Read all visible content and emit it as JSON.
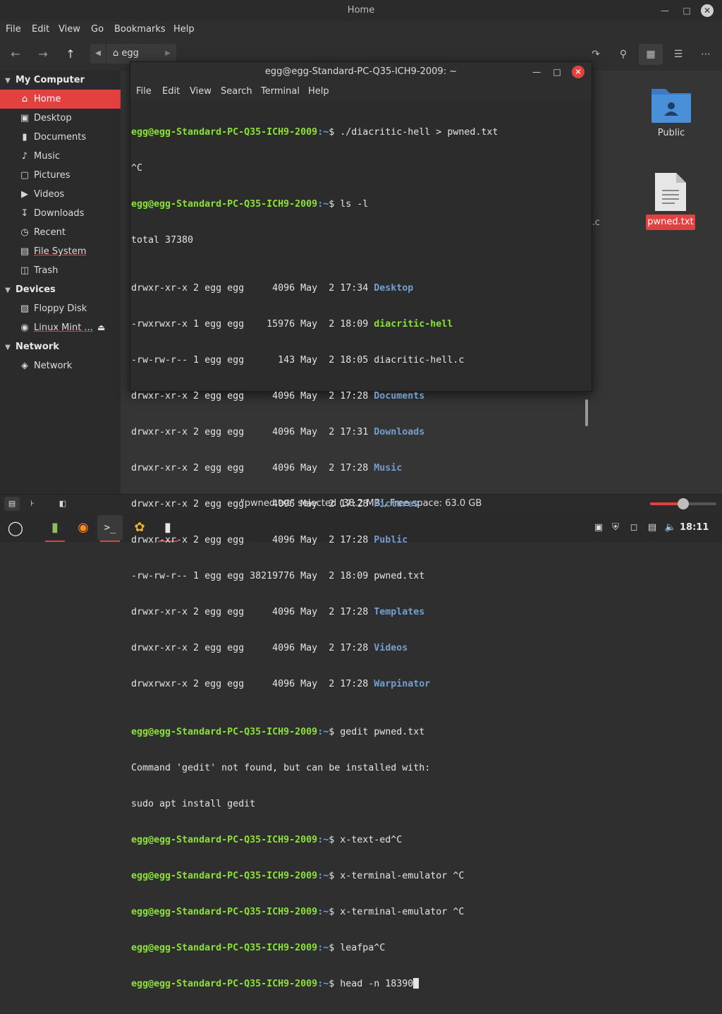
{
  "file_manager": {
    "title": "Home",
    "menu": [
      "File",
      "Edit",
      "View",
      "Go",
      "Bookmarks",
      "Help"
    ],
    "path_label": "egg",
    "sidebar": {
      "my_computer_header": "My Computer",
      "my_computer_items": [
        {
          "label": "Home",
          "icon": "home-icon",
          "active": true
        },
        {
          "label": "Desktop",
          "icon": "desktop-icon"
        },
        {
          "label": "Documents",
          "icon": "documents-icon"
        },
        {
          "label": "Music",
          "icon": "music-icon"
        },
        {
          "label": "Pictures",
          "icon": "pictures-icon"
        },
        {
          "label": "Videos",
          "icon": "videos-icon"
        },
        {
          "label": "Downloads",
          "icon": "downloads-icon"
        },
        {
          "label": "Recent",
          "icon": "recent-icon"
        },
        {
          "label": "File System",
          "icon": "filesystem-icon"
        },
        {
          "label": "Trash",
          "icon": "trash-icon"
        }
      ],
      "devices_header": "Devices",
      "devices_items": [
        {
          "label": "Floppy Disk",
          "icon": "floppy-icon"
        },
        {
          "label": "Linux Mint ...",
          "icon": "disc-icon"
        }
      ],
      "network_header": "Network",
      "network_items": [
        {
          "label": "Network",
          "icon": "network-icon"
        }
      ]
    },
    "content": {
      "public_label": "Public",
      "pwned_label": "pwned.txt",
      "partial_label": "l.c"
    },
    "status": "\"pwned.txt\" selected (38.2 MB), Free space: 63.0 GB",
    "zoom_level": 0.5
  },
  "terminal": {
    "title": "egg@egg-Standard-PC-Q35-ICH9-2009: ~",
    "menu": [
      "File",
      "Edit",
      "View",
      "Search",
      "Terminal",
      "Help"
    ],
    "prompt_user": "egg@egg-Standard-PC-Q35-ICH9-2009",
    "prompt_path": ":~",
    "lines": {
      "l1_cmd": "$ ./diacritic-hell > pwned.txt",
      "l2": "^C",
      "l3_cmd": "$ ls -l",
      "l4": "total 37380",
      "ls": [
        {
          "meta": "drwxr-xr-x 2 egg egg     4096 May  2 17:34 ",
          "name": "Desktop",
          "kind": "dir"
        },
        {
          "meta": "-rwxrwxr-x 1 egg egg    15976 May  2 18:09 ",
          "name": "diacritic-hell",
          "kind": "exe"
        },
        {
          "meta": "-rw-rw-r-- 1 egg egg      143 May  2 18:05 ",
          "name": "diacritic-hell.c",
          "kind": "file"
        },
        {
          "meta": "drwxr-xr-x 2 egg egg     4096 May  2 17:28 ",
          "name": "Documents",
          "kind": "dir"
        },
        {
          "meta": "drwxr-xr-x 2 egg egg     4096 May  2 17:31 ",
          "name": "Downloads",
          "kind": "dir"
        },
        {
          "meta": "drwxr-xr-x 2 egg egg     4096 May  2 17:28 ",
          "name": "Music",
          "kind": "dir"
        },
        {
          "meta": "drwxr-xr-x 2 egg egg     4096 May  2 17:28 ",
          "name": "Pictures",
          "kind": "dir"
        },
        {
          "meta": "drwxr-xr-x 2 egg egg     4096 May  2 17:28 ",
          "name": "Public",
          "kind": "dir"
        },
        {
          "meta": "-rw-rw-r-- 1 egg egg 38219776 May  2 18:09 ",
          "name": "pwned.txt",
          "kind": "file"
        },
        {
          "meta": "drwxr-xr-x 2 egg egg     4096 May  2 17:28 ",
          "name": "Templates",
          "kind": "dir"
        },
        {
          "meta": "drwxr-xr-x 2 egg egg     4096 May  2 17:28 ",
          "name": "Videos",
          "kind": "dir"
        },
        {
          "meta": "drwxrwxr-x 2 egg egg     4096 May  2 17:28 ",
          "name": "Warpinator",
          "kind": "dir"
        }
      ],
      "gedit_cmd": "$ gedit pwned.txt",
      "gedit_err1": "Command 'gedit' not found, but can be installed with:",
      "gedit_err2": "sudo apt install gedit",
      "c1": "$ x-text-ed^C",
      "c2": "$ x-terminal-emulator ^C",
      "c3": "$ x-terminal-emulator ^C",
      "c4": "$ leafpa^C",
      "c5": "$ head -n 18390"
    }
  },
  "taskbar": {
    "clock": "18:11",
    "apps": [
      "menu-icon",
      "files-icon",
      "firefox-icon",
      "terminal-icon",
      "warpinator-icon",
      "text-editor-icon"
    ]
  },
  "colors": {
    "accent": "#e34040",
    "prompt_green": "#8ae234",
    "dir_blue": "#729fcf",
    "folder_blue": "#4a90d9"
  }
}
